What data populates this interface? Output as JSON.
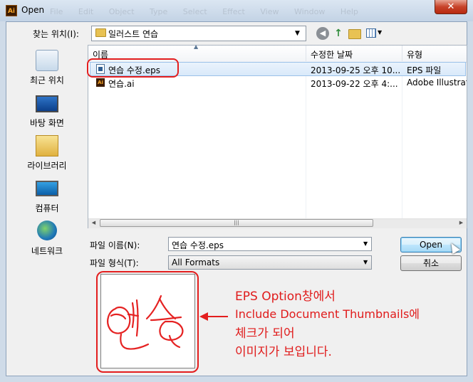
{
  "window": {
    "title": "Open",
    "app_icon": "Ai",
    "menu_ghost": "File Edit Object Type Select Effect View Window Help",
    "close_glyph": "✕"
  },
  "location": {
    "label": "찾는 위치(I):",
    "value": "일러스트 연습"
  },
  "places": [
    {
      "id": "recent",
      "label": "최근 위치",
      "icon": "recent-places-icon"
    },
    {
      "id": "desktop",
      "label": "바탕 화면",
      "icon": "desktop-icon"
    },
    {
      "id": "libraries",
      "label": "라이브러리",
      "icon": "libraries-icon"
    },
    {
      "id": "computer",
      "label": "컴퓨터",
      "icon": "computer-icon"
    },
    {
      "id": "network",
      "label": "네트워크",
      "icon": "network-icon"
    }
  ],
  "columns": {
    "name": "이름",
    "modified": "수정한 날짜",
    "type": "유형"
  },
  "files": [
    {
      "name": "연습 수정.eps",
      "modified": "2013-09-25 오후 10...",
      "type": "EPS 파일",
      "icon": "eps-file-icon",
      "selected": true
    },
    {
      "name": "연습.ai",
      "modified": "2013-09-22 오후 4:...",
      "type": "Adobe Illustrat",
      "icon": "ai-file-icon",
      "selected": false
    }
  ],
  "filename": {
    "label": "파일 이름(N):",
    "value": "연습 수정.eps"
  },
  "filetype": {
    "label": "파일 형식(T):",
    "value": "All Formats"
  },
  "buttons": {
    "open": "Open",
    "cancel": "취소"
  },
  "annotation": {
    "line1": "EPS Option창에서",
    "line2": "Include Document Thumbnails에",
    "line3": "체크가 되어",
    "line4": "이미지가 보입니다."
  },
  "preview_image_text": "연습",
  "colors": {
    "callout": "#e31e1e",
    "selection": "#d9e9fa"
  }
}
